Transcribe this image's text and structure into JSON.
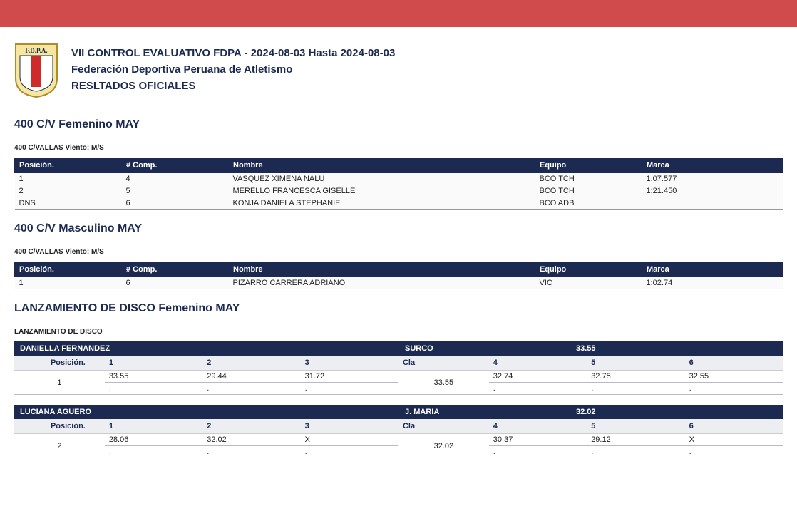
{
  "header": {
    "title_line": "VII CONTROL EVALUATIVO FDPA - 2024-08-03 Hasta 2024-08-03",
    "federation": "Federación Deportiva Peruana de Atletismo",
    "results_label": "RESLTADOS OFICIALES",
    "logo_text": "F.D.P.A."
  },
  "columns": {
    "posicion": "Posición.",
    "comp": "# Comp.",
    "nombre": "Nombre",
    "equipo": "Equipo",
    "marca": "Marca"
  },
  "events": {
    "e1": {
      "title": "400 C/V Femenino MAY",
      "sub": "400 C/VALLAS Viento: M/S",
      "rows": [
        {
          "pos": "1",
          "comp": "4",
          "nombre": "VASQUEZ XIMENA NALU",
          "equipo": "BCO TCH",
          "marca": "1:07.577"
        },
        {
          "pos": "2",
          "comp": "5",
          "nombre": "MERELLO FRANCESCA GISELLE",
          "equipo": "BCO TCH",
          "marca": "1:21.450"
        },
        {
          "pos": "DNS",
          "comp": "6",
          "nombre": "KONJA DANIELA STEPHANIE",
          "equipo": "BCO ADB",
          "marca": ""
        }
      ]
    },
    "e2": {
      "title": "400 C/V Masculino MAY",
      "sub": "400 C/VALLAS Viento: M/S",
      "rows": [
        {
          "pos": "1",
          "comp": "6",
          "nombre": "PIZARRO CARRERA ADRIANO",
          "equipo": "VIC",
          "marca": "1:02.74"
        }
      ]
    },
    "e3": {
      "title": "LANZAMIENTO DE DISCO Femenino MAY",
      "sub": "LANZAMIENTO DE DISCO",
      "throw_cols": {
        "pos": "Posición.",
        "c1": "1",
        "c2": "2",
        "c3": "3",
        "cla": "Cla",
        "c4": "4",
        "c5": "5",
        "c6": "6"
      },
      "athletes": [
        {
          "name": "DANIELLA FERNANDEZ",
          "team": "SURCO",
          "best": "33.55",
          "place": "1",
          "r1": {
            "a": "33.55",
            "b": "."
          },
          "r2": {
            "a": "29.44",
            "b": "."
          },
          "r3": {
            "a": "31.72",
            "b": "."
          },
          "cla": "33.55",
          "r4": {
            "a": "32.74",
            "b": "."
          },
          "r5": {
            "a": "32.75",
            "b": "."
          },
          "r6": {
            "a": "32.55",
            "b": "."
          }
        },
        {
          "name": "LUCIANA AGUERO",
          "team": "J. MARIA",
          "best": "32.02",
          "place": "2",
          "r1": {
            "a": "28.06",
            "b": "."
          },
          "r2": {
            "a": "32.02",
            "b": "."
          },
          "r3": {
            "a": "X",
            "b": "."
          },
          "cla": "32.02",
          "r4": {
            "a": "30.37",
            "b": "."
          },
          "r5": {
            "a": "29.12",
            "b": "."
          },
          "r6": {
            "a": "X",
            "b": "."
          }
        }
      ]
    }
  }
}
